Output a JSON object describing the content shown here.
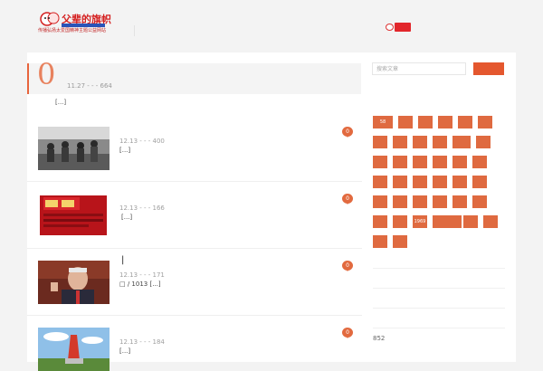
{
  "header": {
    "logo_title": "父辈的旗帜",
    "logo_tagline": "传播弘扬太爱国精神主题公益网站",
    "accent_color": "#e4572e",
    "social_icon": "weibo-icon"
  },
  "featured": {
    "count": "0",
    "meta": "11.27 - - -  664",
    "excerpt": "[...]"
  },
  "posts": [
    {
      "meta": "12.13 - - -  400",
      "title": "",
      "excerpt": "[...]",
      "comments": "0",
      "thumb": "crowd-photo"
    },
    {
      "meta": "12.13 - - -  166",
      "title": "",
      "excerpt": "[...]",
      "comments": "0",
      "thumb": "red-book-cover"
    },
    {
      "meta": "12.13 - - -  171",
      "title": "|",
      "excerpt": "□  /  1013 [...]",
      "comments": "0",
      "thumb": "speaker-portrait"
    },
    {
      "meta": "12.13 - - -  184",
      "title": "",
      "excerpt": "[...]",
      "comments": "0",
      "thumb": "monument-photo"
    }
  ],
  "sidebar": {
    "search_placeholder": "搜索文章",
    "tags": [
      "58",
      "",
      "",
      "",
      "",
      "",
      "",
      "",
      "",
      "",
      "",
      "",
      "",
      "",
      "",
      "",
      "",
      "",
      "",
      "",
      "",
      "",
      "",
      "",
      "",
      "",
      "",
      "",
      "",
      "",
      "",
      "",
      "1969",
      "",
      "",
      "",
      ""
    ],
    "count": "852"
  }
}
